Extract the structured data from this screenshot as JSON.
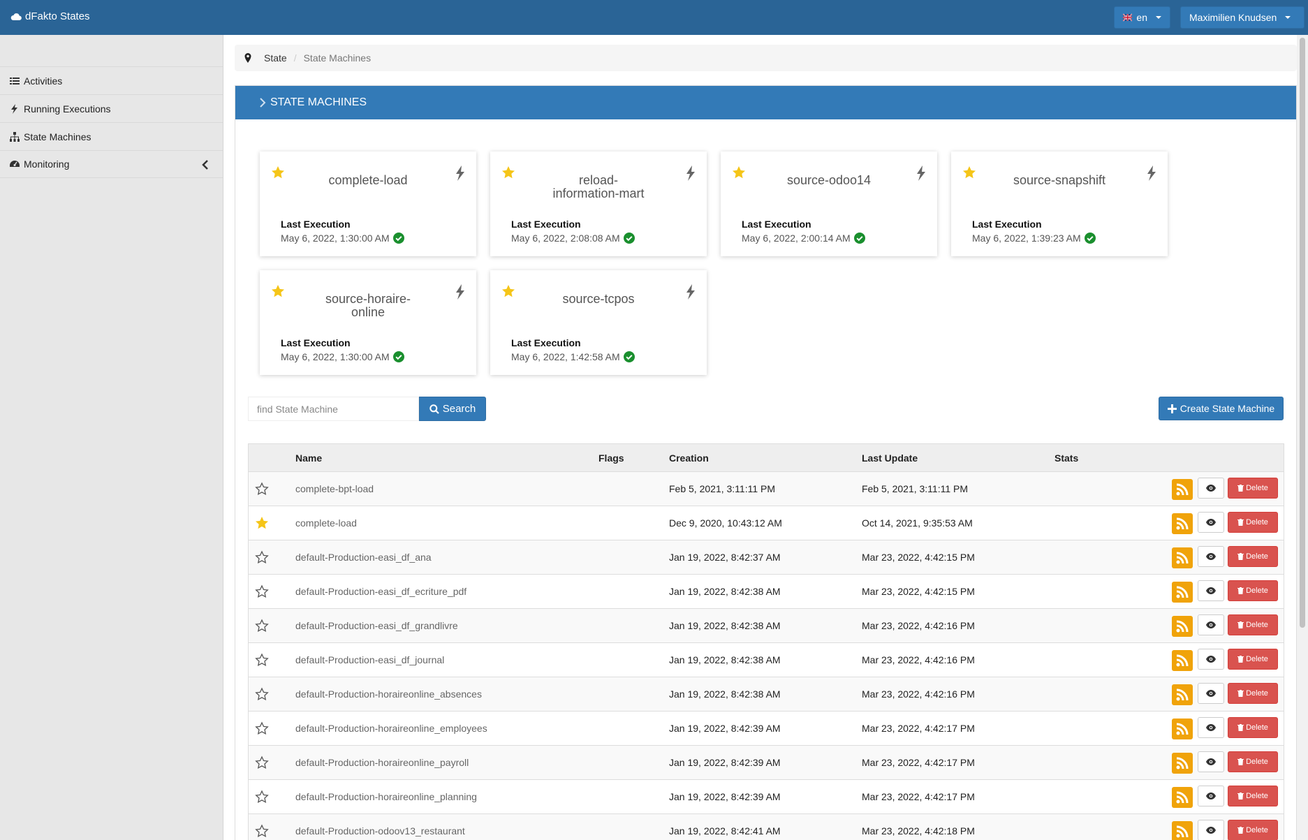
{
  "app": {
    "title": "dFakto States",
    "language": "en",
    "user": "Maximilien Knudsen"
  },
  "sidebar": {
    "items": [
      {
        "label": "Activities",
        "icon": "list-icon"
      },
      {
        "label": "Running Executions",
        "icon": "bolt-icon"
      },
      {
        "label": "State Machines",
        "icon": "sitemap-icon"
      },
      {
        "label": "Monitoring",
        "icon": "dashboard-icon"
      }
    ]
  },
  "breadcrumb": {
    "items": [
      "State",
      "State Machines"
    ]
  },
  "panel": {
    "title": "STATE MACHINES"
  },
  "favorites": [
    {
      "name": "complete-load",
      "last_label": "Last Execution",
      "last_date": "May 6, 2022, 1:30:00 AM"
    },
    {
      "name": "reload-\ninformation-mart",
      "last_label": "Last Execution",
      "last_date": "May 6, 2022, 2:08:08 AM"
    },
    {
      "name": "source-odoo14",
      "last_label": "Last Execution",
      "last_date": "May 6, 2022, 2:00:14 AM"
    },
    {
      "name": "source-snapshift",
      "last_label": "Last Execution",
      "last_date": "May 6, 2022, 1:39:23 AM"
    },
    {
      "name": "source-horaire-\nonline",
      "last_label": "Last Execution",
      "last_date": "May 6, 2022, 1:30:00 AM"
    },
    {
      "name": "source-tcpos",
      "last_label": "Last Execution",
      "last_date": "May 6, 2022, 1:42:58 AM"
    }
  ],
  "search": {
    "placeholder": "find State Machine",
    "value": "",
    "button": "Search"
  },
  "create_button": "Create State Machine",
  "table": {
    "headers": {
      "name": "Name",
      "flags": "Flags",
      "creation": "Creation",
      "last_update": "Last Update",
      "stats": "Stats"
    },
    "delete_label": "Delete",
    "rows": [
      {
        "favorite": false,
        "name": "complete-bpt-load",
        "creation": "Feb 5, 2021, 3:11:11 PM",
        "last_update": "Feb 5, 2021, 3:11:11 PM"
      },
      {
        "favorite": true,
        "name": "complete-load",
        "creation": "Dec 9, 2020, 10:43:12 AM",
        "last_update": "Oct 14, 2021, 9:35:53 AM"
      },
      {
        "favorite": false,
        "name": "default-Production-easi_df_ana",
        "creation": "Jan 19, 2022, 8:42:37 AM",
        "last_update": "Mar 23, 2022, 4:42:15 PM"
      },
      {
        "favorite": false,
        "name": "default-Production-easi_df_ecriture_pdf",
        "creation": "Jan 19, 2022, 8:42:38 AM",
        "last_update": "Mar 23, 2022, 4:42:15 PM"
      },
      {
        "favorite": false,
        "name": "default-Production-easi_df_grandlivre",
        "creation": "Jan 19, 2022, 8:42:38 AM",
        "last_update": "Mar 23, 2022, 4:42:16 PM"
      },
      {
        "favorite": false,
        "name": "default-Production-easi_df_journal",
        "creation": "Jan 19, 2022, 8:42:38 AM",
        "last_update": "Mar 23, 2022, 4:42:16 PM"
      },
      {
        "favorite": false,
        "name": "default-Production-horaireonline_absences",
        "creation": "Jan 19, 2022, 8:42:38 AM",
        "last_update": "Mar 23, 2022, 4:42:16 PM"
      },
      {
        "favorite": false,
        "name": "default-Production-horaireonline_employees",
        "creation": "Jan 19, 2022, 8:42:39 AM",
        "last_update": "Mar 23, 2022, 4:42:17 PM"
      },
      {
        "favorite": false,
        "name": "default-Production-horaireonline_payroll",
        "creation": "Jan 19, 2022, 8:42:39 AM",
        "last_update": "Mar 23, 2022, 4:42:17 PM"
      },
      {
        "favorite": false,
        "name": "default-Production-horaireonline_planning",
        "creation": "Jan 19, 2022, 8:42:39 AM",
        "last_update": "Mar 23, 2022, 4:42:17 PM"
      },
      {
        "favorite": false,
        "name": "default-Production-odoov13_restaurant",
        "creation": "Jan 19, 2022, 8:42:41 AM",
        "last_update": "Mar 23, 2022, 4:42:18 PM"
      }
    ]
  },
  "colors": {
    "navbar": "#2a6496",
    "primary": "#337ab7",
    "danger": "#d9534f",
    "rss": "#f0a30a",
    "star": "#f5c518",
    "success": "#1a8f2e"
  }
}
